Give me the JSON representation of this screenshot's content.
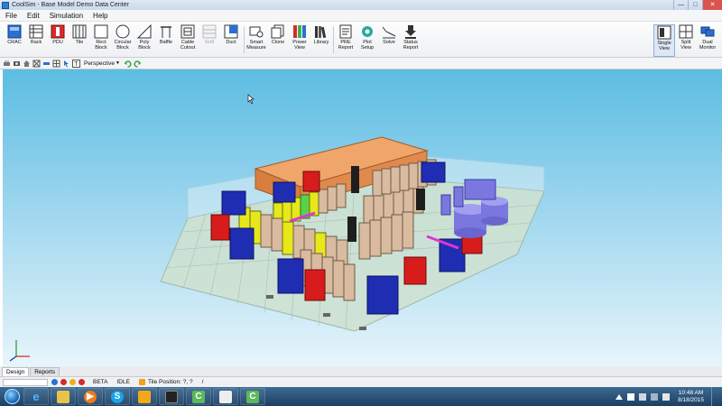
{
  "window": {
    "title": "CoolSim - Base Model Demo Data Center",
    "controls": {
      "minimize": "—",
      "maximize": "□",
      "close": "✕"
    }
  },
  "menu": [
    "File",
    "Edit",
    "Simulation",
    "Help"
  ],
  "toolbar": {
    "tools": [
      {
        "label": "CRAC",
        "icon": "crac-icon"
      },
      {
        "label": "Rack",
        "icon": "rack-icon"
      },
      {
        "label": "PDU",
        "icon": "pdu-icon"
      },
      {
        "label": "Tile",
        "icon": "tile-icon"
      },
      {
        "label": "Rect\nBlock",
        "icon": "rect-block-icon"
      },
      {
        "label": "Circular\nBlock",
        "icon": "circular-block-icon"
      },
      {
        "label": "Poly\nBlock",
        "icon": "poly-block-icon"
      },
      {
        "label": "Baffle",
        "icon": "baffle-icon"
      },
      {
        "label": "Cable\nCutout",
        "icon": "cable-cutout-icon"
      },
      {
        "label": "Grill",
        "icon": "grill-icon",
        "disabled": true
      },
      {
        "label": "Duct",
        "icon": "duct-icon"
      },
      {
        "label": "Smart\nMeasure",
        "icon": "smart-measure-icon"
      },
      {
        "label": "Clone",
        "icon": "clone-icon"
      },
      {
        "label": "Power\nView",
        "icon": "power-view-icon"
      },
      {
        "label": "Library",
        "icon": "library-icon"
      },
      {
        "label": "PRE\nReport",
        "icon": "pre-report-icon"
      },
      {
        "label": "Plot\nSetup",
        "icon": "plot-setup-icon"
      },
      {
        "label": "Solve",
        "icon": "solve-icon"
      },
      {
        "label": "Status\nReport",
        "icon": "status-report-icon"
      }
    ],
    "views": [
      {
        "label": "Single\nView",
        "icon": "single-view-icon",
        "active": true
      },
      {
        "label": "Split\nView",
        "icon": "split-view-icon"
      },
      {
        "label": "Dual\nMonitor",
        "icon": "dual-monitor-icon"
      }
    ]
  },
  "viewbar": {
    "projection": "Perspective"
  },
  "tabs": [
    "Design",
    "Reports"
  ],
  "status": {
    "beta": "BETA",
    "idle": "IDLE",
    "tile_position": "Tile Position: ?, ?",
    "slash": "/"
  },
  "taskbar": {
    "time": "10:48 AM",
    "date": "8/18/2015"
  },
  "colors": {
    "rack": "#d9bba0",
    "crac": "#1f2db3",
    "pdu": "#d81c1c",
    "room_wall": "#e08a4e",
    "highlight_rack": "#e6e81a",
    "cylinder": "#7b77e0"
  }
}
